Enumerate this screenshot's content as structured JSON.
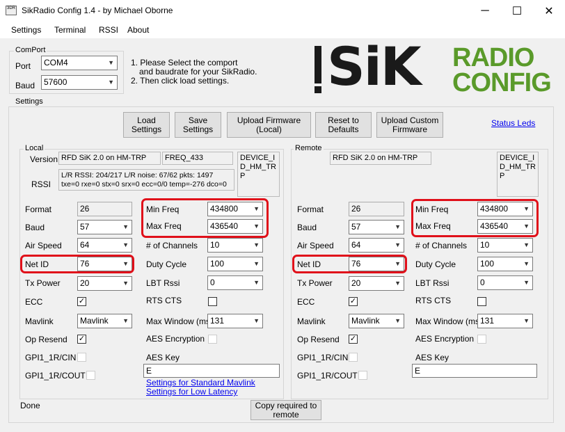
{
  "window": {
    "title": "SikRadio Config 1.4 - by Michael Oborne",
    "app_icon_text": "3DR",
    "minimize": "─",
    "maximize": "☐",
    "close": "✕"
  },
  "menu": [
    "Settings",
    "Terminal",
    "RSSI",
    "About"
  ],
  "comport": {
    "title": "ComPort",
    "port_label": "Port",
    "port_value": "COM4",
    "baud_label": "Baud",
    "baud_value": "57600"
  },
  "instructions": {
    "line1": "1. Please Select the comport",
    "line2": "and baudrate for your SikRadio.",
    "line3": "2. Then click load settings."
  },
  "logo": {
    "sik": "SiK",
    "radio": "RADIO",
    "config": "CONFIG",
    "colors": {
      "sik": "#1a1a1a",
      "accent": "#5a9a2a"
    }
  },
  "settings": {
    "title": "Settings",
    "buttons": {
      "load": [
        "Load",
        "Settings"
      ],
      "save": [
        "Save",
        "Settings"
      ],
      "upload_fw": [
        "Upload Firmware",
        "(Local)"
      ],
      "reset": [
        "Reset to",
        "Defaults"
      ],
      "upload_custom": [
        "Upload Custom",
        "Firmware"
      ]
    },
    "status_leds": "Status Leds",
    "copy_remote": [
      "Copy required to",
      "remote"
    ],
    "status": "Done",
    "link_mavlink": "Settings for Standard Mavlink",
    "link_latency": "Settings for Low Latency"
  },
  "local": {
    "title": "Local",
    "version_label": "Version",
    "version": "RFD SiK 2.0 on HM-TRP",
    "freq": "FREQ_433",
    "device_id": [
      "DEVICE_I",
      "D_HM_TR",
      "P"
    ],
    "rssi_label": "RSSI",
    "rssi_line1": "L/R RSSI: 204/217  L/R noise: 67/62 pkts: 1497",
    "rssi_line2": "txe=0 rxe=0 stx=0 srx=0 ecc=0/0 temp=-276 dco=0",
    "format_label": "Format",
    "format": "26",
    "baud_label": "Baud",
    "baud": "57",
    "airspeed_label": "Air Speed",
    "airspeed": "64",
    "netid_label": "Net ID",
    "netid": "76",
    "txpower_label": "Tx Power",
    "txpower": "20",
    "ecc_label": "ECC",
    "ecc": "✓",
    "mavlink_label": "Mavlink",
    "mavlink": "Mavlink",
    "opresend_label": "Op Resend",
    "opresend": "✓",
    "gpi1_label": "GPI1_1R/CIN",
    "gpi2_label": "GPI1_1R/COUT",
    "minfreq_label": "Min Freq",
    "minfreq": "434800",
    "maxfreq_label": "Max Freq",
    "maxfreq": "436540",
    "channels_label": "# of Channels",
    "channels": "10",
    "duty_label": "Duty Cycle",
    "duty": "100",
    "lbt_label": "LBT Rssi",
    "lbt": "0",
    "rtscts_label": "RTS CTS",
    "maxwin_label": "Max Window (ms)",
    "maxwin": "131",
    "aes_enc_label": "AES Encryption",
    "aes_key_label": "AES Key",
    "aes_key": "E"
  },
  "remote": {
    "title": "Remote",
    "version": "RFD SiK 2.0 on HM-TRP",
    "device_id": [
      "DEVICE_I",
      "D_HM_TR",
      "P"
    ],
    "format_label": "Format",
    "format": "26",
    "baud_label": "Baud",
    "baud": "57",
    "airspeed_label": "Air Speed",
    "airspeed": "64",
    "netid_label": "Net ID",
    "netid": "76",
    "txpower_label": "Tx Power",
    "txpower": "20",
    "ecc_label": "ECC",
    "ecc": "✓",
    "mavlink_label": "Mavlink",
    "mavlink": "Mavlink",
    "opresend_label": "Op Resend",
    "opresend": "✓",
    "gpi1_label": "GPI1_1R/CIN",
    "gpi2_label": "GPI1_1R/COUT",
    "minfreq_label": "Min Freq",
    "minfreq": "434800",
    "maxfreq_label": "Max Freq",
    "maxfreq": "436540",
    "channels_label": "# of Channels",
    "channels": "10",
    "duty_label": "Duty Cycle",
    "duty": "100",
    "lbt_label": "LBT Rssi",
    "lbt": "0",
    "rtscts_label": "RTS CTS",
    "maxwin_label": "Max Window (ms)",
    "maxwin": "131",
    "aes_enc_label": "AES Encryption",
    "aes_key_label": "AES Key",
    "aes_key": "E"
  }
}
